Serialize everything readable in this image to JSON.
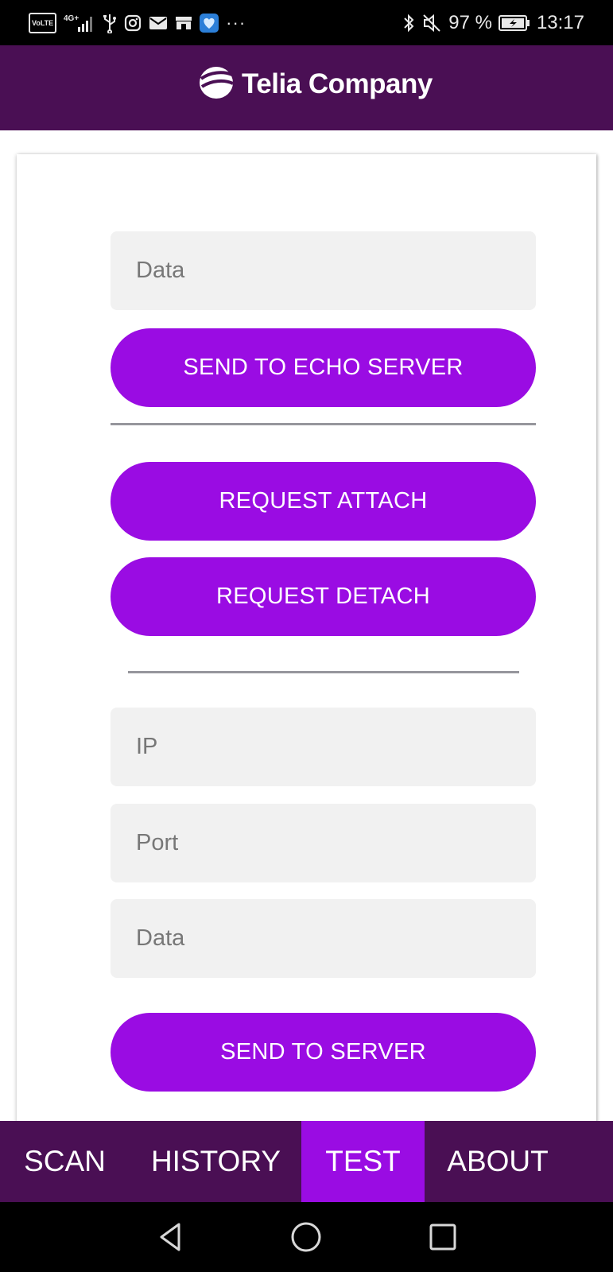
{
  "status_bar": {
    "left_icons": [
      "volte-icon",
      "4g-signal-icon",
      "usb-icon",
      "instagram-icon",
      "mail-icon",
      "store-icon",
      "heart-app-icon",
      "more-dots-icon"
    ],
    "volte_label": "VoLTE",
    "network_label": "4G+",
    "more_label": "···",
    "battery_percent": "97 %",
    "time": "13:17"
  },
  "header": {
    "brand_name": "Telia Company"
  },
  "form": {
    "echo_data_placeholder": "Data",
    "send_echo_label": "SEND TO ECHO SERVER",
    "request_attach_label": "REQUEST ATTACH",
    "request_detach_label": "REQUEST DETACH",
    "ip_placeholder": "IP",
    "port_placeholder": "Port",
    "server_data_placeholder": "Data",
    "send_server_label": "SEND TO SERVER"
  },
  "tabs": [
    {
      "label": "SCAN",
      "active": false
    },
    {
      "label": "HISTORY",
      "active": false
    },
    {
      "label": "TEST",
      "active": true
    },
    {
      "label": "ABOUT",
      "active": false
    }
  ],
  "colors": {
    "header_bg": "#4a0f54",
    "accent": "#9a0ce3",
    "field_bg": "#f1f1f1"
  }
}
